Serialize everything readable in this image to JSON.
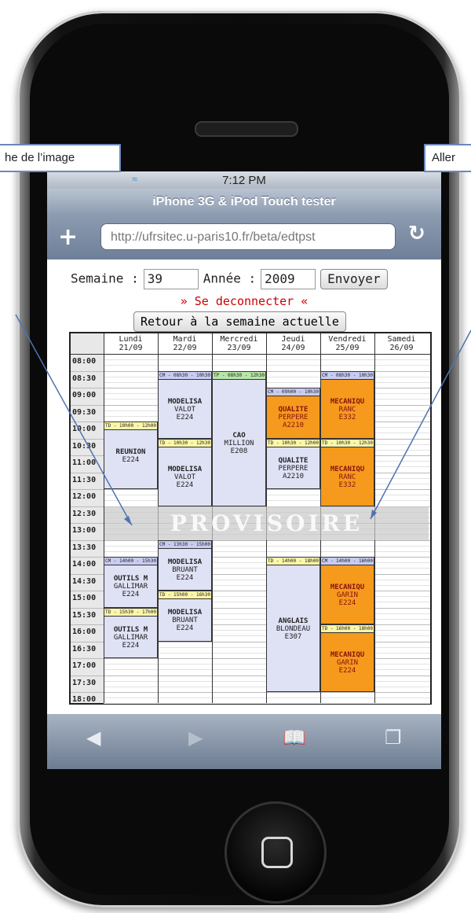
{
  "callouts": {
    "left": "he de l’image",
    "right": "Aller"
  },
  "statusbar": {
    "time": "7:12 PM",
    "wifi_icon": "wifi-icon"
  },
  "browser": {
    "title": "iPhone 3G & iPod Touch tester",
    "url": "http://ufrsitec.u-paris10.fr/beta/edtpst",
    "add_icon": "plus-icon",
    "reload_icon": "reload-icon"
  },
  "form": {
    "week_label": "Semaine :",
    "week_value": "39",
    "year_label": "Année :",
    "year_value": "2009",
    "submit_label": "Envoyer",
    "logout_label": "» Se deconnecter «",
    "current_week_label": "Retour à la semaine actuelle"
  },
  "schedule": {
    "hours": [
      "08:00",
      "08:30",
      "09:00",
      "09:30",
      "10:00",
      "10:30",
      "11:00",
      "11:30",
      "12:00",
      "12:30",
      "13:00",
      "13:30",
      "14:00",
      "14:30",
      "15:00",
      "15:30",
      "16:00",
      "16:30",
      "17:00",
      "17:30",
      "18:00"
    ],
    "days": [
      {
        "name": "Lundi",
        "date": "21/09"
      },
      {
        "name": "Mardi",
        "date": "22/09"
      },
      {
        "name": "Mercredi",
        "date": "23/09"
      },
      {
        "name": "Jeudi",
        "date": "24/09"
      },
      {
        "name": "Vendredi",
        "date": "25/09"
      },
      {
        "name": "Samedi",
        "date": "26/09"
      }
    ],
    "watermark": "PROVISOIRE",
    "events": [
      {
        "day": 0,
        "start": "10:00",
        "end": "12:00",
        "tag": "TD - 10h00 - 12h00",
        "tagtype": "td",
        "color": "blue",
        "title": "REUNION",
        "line2": "",
        "line3": "E224"
      },
      {
        "day": 0,
        "start": "14:00",
        "end": "15:30",
        "tag": "CM - 14h00 - 15h30",
        "tagtype": "cm",
        "color": "blue",
        "title": "OUTILS M",
        "line2": "GALLIMAR",
        "line3": "E224"
      },
      {
        "day": 0,
        "start": "15:30",
        "end": "17:00",
        "tag": "TD - 15h30 - 17h00",
        "tagtype": "td",
        "color": "blue",
        "title": "OUTILS M",
        "line2": "GALLIMAR",
        "line3": "E224"
      },
      {
        "day": 1,
        "start": "08:30",
        "end": "10:30",
        "tag": "CM - 08h30 - 10h30",
        "tagtype": "cm",
        "color": "blue",
        "title": "MODELISA",
        "line2": "VALOT",
        "line3": "E224"
      },
      {
        "day": 1,
        "start": "10:30",
        "end": "12:30",
        "tag": "TD - 10h30 - 12h30",
        "tagtype": "td",
        "color": "blue",
        "title": "MODELISA",
        "line2": "VALOT",
        "line3": "E224"
      },
      {
        "day": 1,
        "start": "13:30",
        "end": "15:00",
        "tag": "CM - 13h30 - 15h00",
        "tagtype": "cm",
        "color": "blue",
        "title": "MODELISA",
        "line2": "BRUANT",
        "line3": "E224"
      },
      {
        "day": 1,
        "start": "15:00",
        "end": "16:30",
        "tag": "TD - 15h00 - 16h30",
        "tagtype": "td",
        "color": "blue",
        "title": "MODELISA",
        "line2": "BRUANT",
        "line3": "E224"
      },
      {
        "day": 2,
        "start": "08:30",
        "end": "12:30",
        "tag": "TP - 08h30 - 12h30",
        "tagtype": "tp",
        "color": "blue",
        "title": "CAO",
        "line2": "MILLION",
        "line3": "E208"
      },
      {
        "day": 3,
        "start": "09:00",
        "end": "10:30",
        "tag": "CM - 09h00 - 10h30",
        "tagtype": "cm",
        "color": "orange",
        "title": "QUALITE",
        "line2": "PERPERE",
        "line3": "A2210"
      },
      {
        "day": 3,
        "start": "10:30",
        "end": "12:00",
        "tag": "TD - 10h30 - 12h00",
        "tagtype": "td",
        "color": "blue",
        "title": "QUALITE",
        "line2": "PERPERE",
        "line3": "A2210"
      },
      {
        "day": 3,
        "start": "14:00",
        "end": "18:00",
        "tag": "TD - 14h00 - 18h00",
        "tagtype": "td",
        "color": "blue",
        "title": "ANGLAIS",
        "line2": "BLONDEAU",
        "line3": "E307"
      },
      {
        "day": 4,
        "start": "08:30",
        "end": "10:30",
        "tag": "CM - 08h30 - 10h30",
        "tagtype": "cm",
        "color": "orange",
        "title": "MECANIQU",
        "line2": "RANC",
        "line3": "E332"
      },
      {
        "day": 4,
        "start": "10:30",
        "end": "12:30",
        "tag": "TD - 10h30 - 12h30",
        "tagtype": "td",
        "color": "orange",
        "title": "MECANIQU",
        "line2": "RANC",
        "line3": "E332"
      },
      {
        "day": 4,
        "start": "14:00",
        "end": "16:00",
        "tag": "CM - 14h00 - 16h00",
        "tagtype": "cm",
        "color": "orange",
        "title": "MECANIQU",
        "line2": "GARIN",
        "line3": "E224"
      },
      {
        "day": 4,
        "start": "16:00",
        "end": "18:00",
        "tag": "TD - 16h00 - 18h00",
        "tagtype": "td",
        "color": "orange",
        "title": "MECANIQU",
        "line2": "GARIN",
        "line3": "E224"
      }
    ]
  },
  "toolbar": {
    "icons": [
      "back-icon",
      "forward-icon",
      "bookmarks-icon",
      "pages-icon"
    ]
  }
}
